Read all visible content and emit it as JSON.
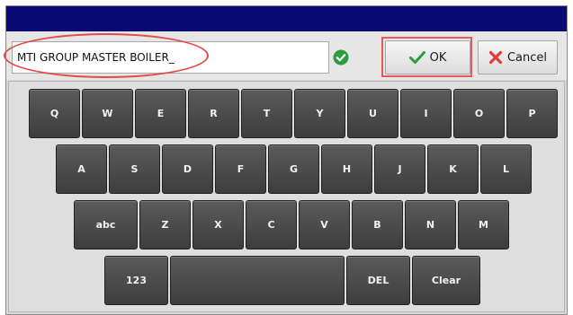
{
  "input": {
    "value": "MTI GROUP MASTER BOILER_"
  },
  "buttons": {
    "ok_label": "OK",
    "cancel_label": "Cancel"
  },
  "colors": {
    "titlebar": "#0b0b76",
    "key": "#4a4a4a",
    "valid": "#2e9b3f",
    "ok_check": "#2e9b3f",
    "cancel_x": "#e23b3b",
    "annotation": "#e34a4a"
  },
  "keyboard": {
    "row1": [
      "Q",
      "W",
      "E",
      "R",
      "T",
      "Y",
      "U",
      "I",
      "O",
      "P"
    ],
    "row2": [
      "A",
      "S",
      "D",
      "F",
      "G",
      "H",
      "J",
      "K",
      "L"
    ],
    "row3": [
      "abc",
      "Z",
      "X",
      "C",
      "V",
      "B",
      "N",
      "M"
    ],
    "row4": [
      "123",
      "",
      "DEL",
      "Clear"
    ]
  }
}
